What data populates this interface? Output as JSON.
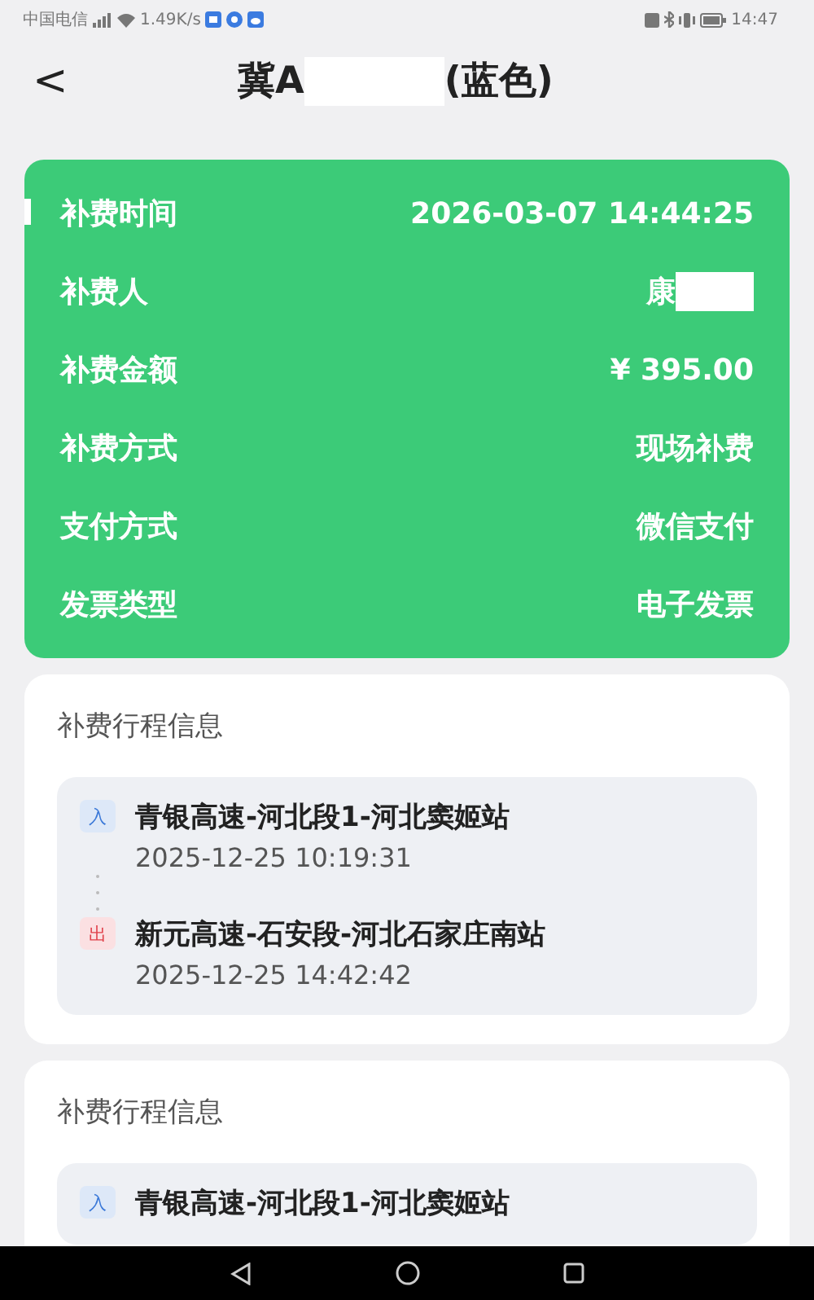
{
  "status_bar": {
    "carrier": "中国电信",
    "speed": "1.49K/s",
    "time": "14:47"
  },
  "header": {
    "back": "<",
    "plate_prefix": "冀A",
    "plate_color": "(蓝色)"
  },
  "summary": [
    {
      "label": "补费时间",
      "value": "2026-03-07 14:44:25",
      "redacted": false
    },
    {
      "label": "补费人",
      "value": "康",
      "redacted": true
    },
    {
      "label": "补费金额",
      "value": "¥ 395.00",
      "redacted": false
    },
    {
      "label": "补费方式",
      "value": "现场补费",
      "redacted": false
    },
    {
      "label": "支付方式",
      "value": "微信支付",
      "redacted": false
    },
    {
      "label": "发票类型",
      "value": "电子发票",
      "redacted": false
    }
  ],
  "trips": [
    {
      "title": "补费行程信息",
      "stops": [
        {
          "kind": "entry",
          "badge": "入",
          "station": "青银高速-河北段1-河北窦姬站",
          "time": "2025-12-25 10:19:31"
        },
        {
          "kind": "exit",
          "badge": "出",
          "station": "新元高速-石安段-河北石家庄南站",
          "time": "2025-12-25 14:42:42"
        }
      ]
    },
    {
      "title": "补费行程信息",
      "stops": [
        {
          "kind": "entry",
          "badge": "入",
          "station": "青银高速-河北段1-河北窦姬站"
        }
      ]
    }
  ]
}
